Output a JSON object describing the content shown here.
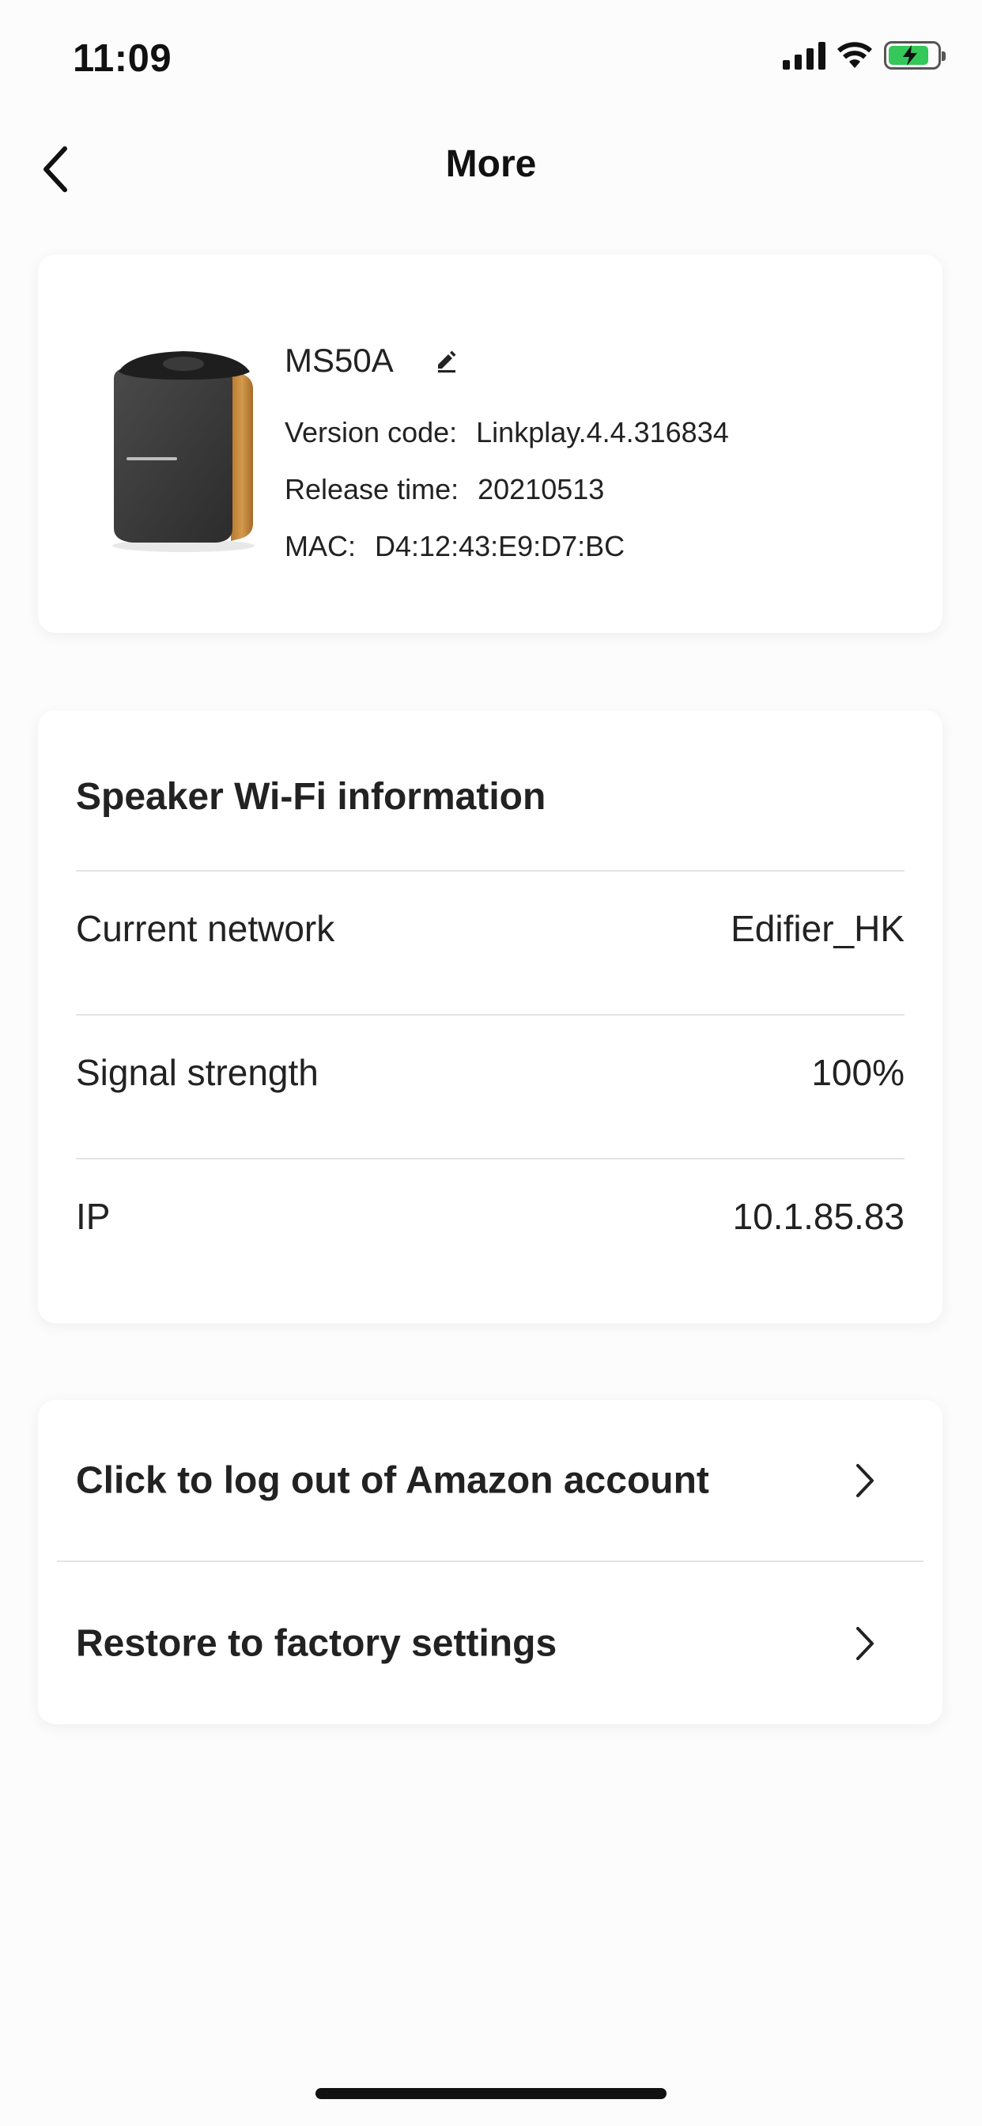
{
  "status_bar": {
    "time": "11:09",
    "icons": [
      "cellular-signal-icon",
      "wifi-icon",
      "battery-charging-icon"
    ],
    "battery_color": "#34c759"
  },
  "nav": {
    "title": "More",
    "back_icon": "chevron-left-icon"
  },
  "device": {
    "name": "MS50A",
    "edit_icon": "pencil-icon",
    "version_label": "Version code:",
    "version_value": "Linkplay.4.4.316834",
    "release_label": "Release time:",
    "release_value": "20210513",
    "mac_label": "MAC:",
    "mac_value": "D4:12:43:E9:D7:BC"
  },
  "wifi": {
    "title": "Speaker Wi-Fi information",
    "rows": [
      {
        "label": "Current network",
        "value": "Edifier_HK"
      },
      {
        "label": "Signal strength",
        "value": "100%"
      },
      {
        "label": "IP",
        "value": "10.1.85.83"
      }
    ]
  },
  "actions": [
    {
      "label": "Click to log out of Amazon account",
      "icon": "chevron-right-icon"
    },
    {
      "label": "Restore to factory settings",
      "icon": "chevron-right-icon"
    }
  ]
}
